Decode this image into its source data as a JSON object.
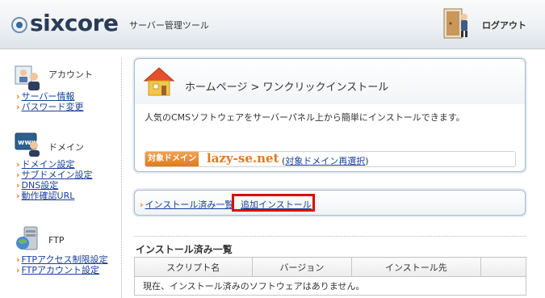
{
  "header": {
    "logo_text": "sixcore",
    "logo_subtitle": "サーバー管理ツール",
    "logout_label": "ログアウト"
  },
  "sidebar": {
    "sections": [
      {
        "title": "アカウント",
        "icon": "account-icon",
        "links": [
          "サーバー情報",
          "パスワード変更"
        ]
      },
      {
        "title": "ドメイン",
        "icon": "www-domain-icon",
        "links": [
          "ドメイン設定",
          "サブドメイン設定",
          "DNS設定",
          "動作確認URL"
        ]
      },
      {
        "title": "FTP",
        "icon": "ftp-icon",
        "links": [
          "FTPアクセス制限設定",
          "FTPアカウント設定"
        ]
      }
    ]
  },
  "main": {
    "title": "ホームページ > ワンクリックインストール",
    "description": "人気のCMSソフトウェアをサーバーパネル上から簡単にインストールできます。",
    "domain_badge": "対象ドメイン",
    "domain_name": "lazy-se.net",
    "domain_change_link": "対象ドメイン再選択",
    "tabs": [
      "インストール済み一覧",
      "追加インストール"
    ],
    "installed_section_title": "インストール済み一覧",
    "table": {
      "headers": [
        "スクリプト名",
        "バージョン",
        "インストール先",
        ""
      ],
      "empty_message": "現在、インストール済みのソフトウェアはありません。"
    }
  },
  "colors": {
    "accent_orange": "#e07b1c",
    "link_blue": "#1a3f99",
    "highlight_red": "#e00000",
    "logo_dark": "#2a3c56"
  }
}
